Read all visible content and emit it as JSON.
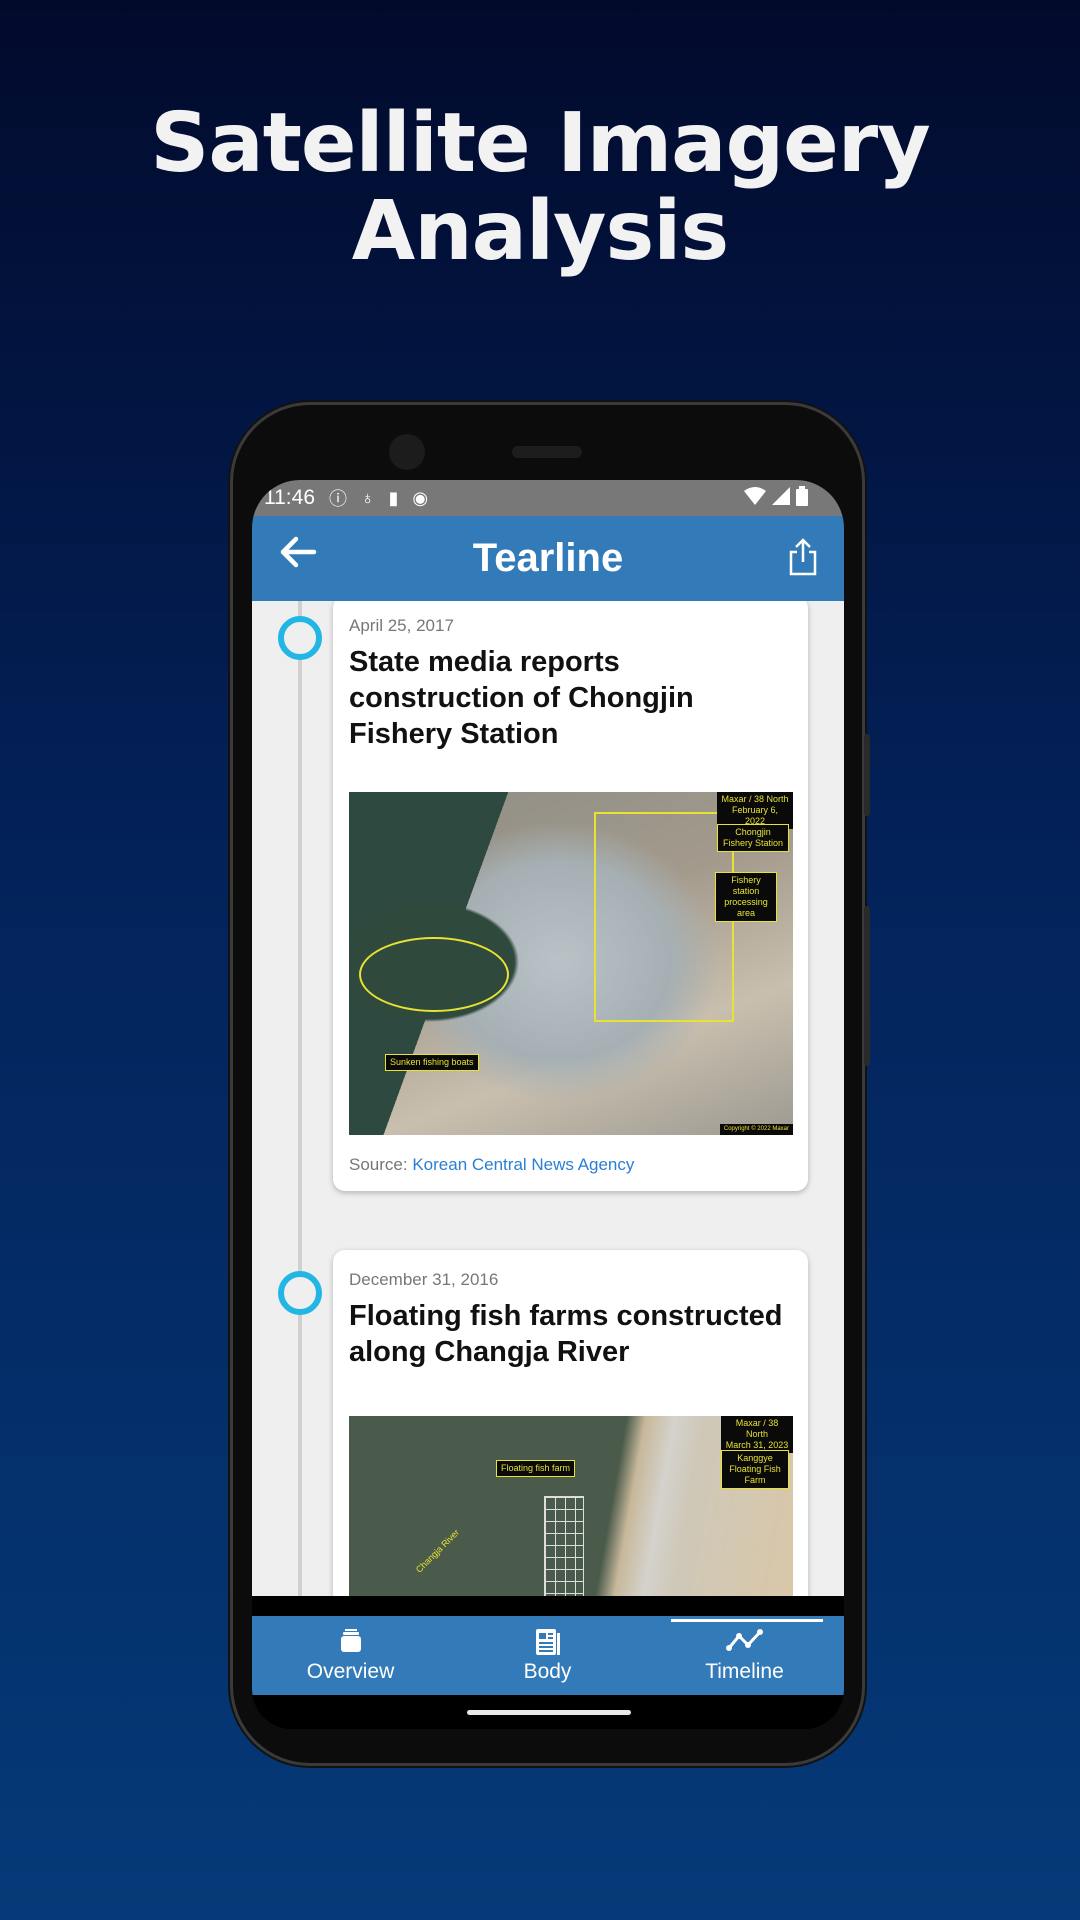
{
  "headline": {
    "line1": "Satellite Imagery",
    "line2": "Analysis"
  },
  "status_bar": {
    "time": "11:46"
  },
  "app_bar": {
    "title": "Tearline",
    "back_icon": "arrow-left-icon",
    "share_icon": "share-icon"
  },
  "colors": {
    "app_bar": "#337ab8",
    "timeline_dot": "#21b6e4",
    "link": "#2a7fd4"
  },
  "timeline": [
    {
      "date": "April 25, 2017",
      "title": "State media reports construction of Chongjin Fishery Station",
      "image_labels": {
        "credit_1": "Maxar / 38 North",
        "credit_2": "February 6, 2022",
        "name": "Chongjin Fishery Station",
        "area": "Fishery station processing area",
        "boats": "Sunken fishing boats",
        "copyright": "Copyright © 2022 Maxar"
      },
      "source_label": "Source:",
      "source_link": "Korean Central News Agency"
    },
    {
      "date": "December 31, 2016",
      "title": "Floating fish farms constructed along Changja River",
      "image_labels": {
        "credit_1": "Maxar / 38 North",
        "credit_2": "March 31, 2023",
        "name": "Kanggye Floating Fish Farm",
        "farm": "Floating fish farm",
        "river": "Changja River"
      }
    }
  ],
  "bottom_nav": {
    "items": [
      {
        "label": "Overview",
        "icon": "cards-icon"
      },
      {
        "label": "Body",
        "icon": "newspaper-icon"
      },
      {
        "label": "Timeline",
        "icon": "timeline-icon"
      }
    ],
    "active": "Timeline"
  }
}
